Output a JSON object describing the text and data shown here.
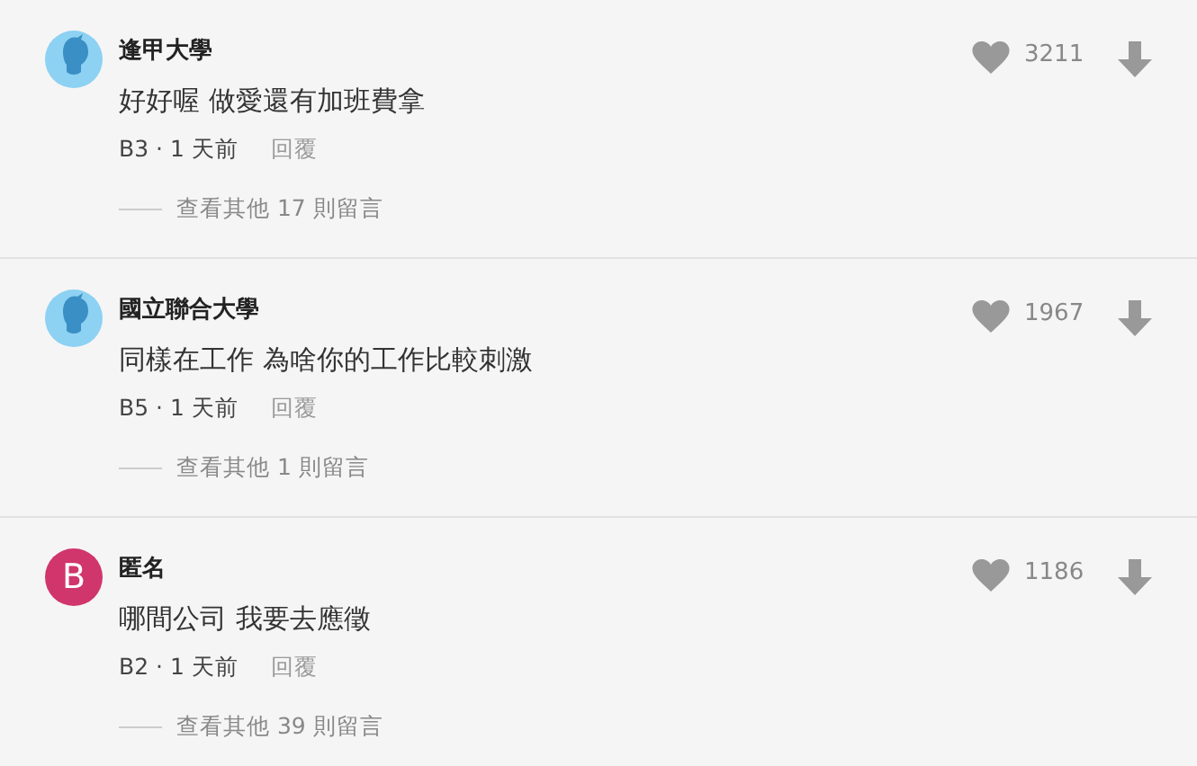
{
  "comments": [
    {
      "author": "逢甲大學",
      "avatar": {
        "kind": "silhouette"
      },
      "text": "好好喔 做愛還有加班費拿",
      "meta": "B3 · 1 天前",
      "reply": "回覆",
      "likes": "3211",
      "more_replies": "查看其他 17 則留言"
    },
    {
      "author": "國立聯合大學",
      "avatar": {
        "kind": "silhouette"
      },
      "text": "同樣在工作 為啥你的工作比較刺激",
      "meta": "B5 · 1 天前",
      "reply": "回覆",
      "likes": "1967",
      "more_replies": "查看其他 1 則留言"
    },
    {
      "author": "匿名",
      "avatar": {
        "kind": "letter",
        "letter": "B",
        "color": "#d0356b"
      },
      "text": "哪間公司 我要去應徵",
      "meta": "B2 · 1 天前",
      "reply": "回覆",
      "likes": "1186",
      "more_replies": "查看其他 39 則留言"
    }
  ]
}
